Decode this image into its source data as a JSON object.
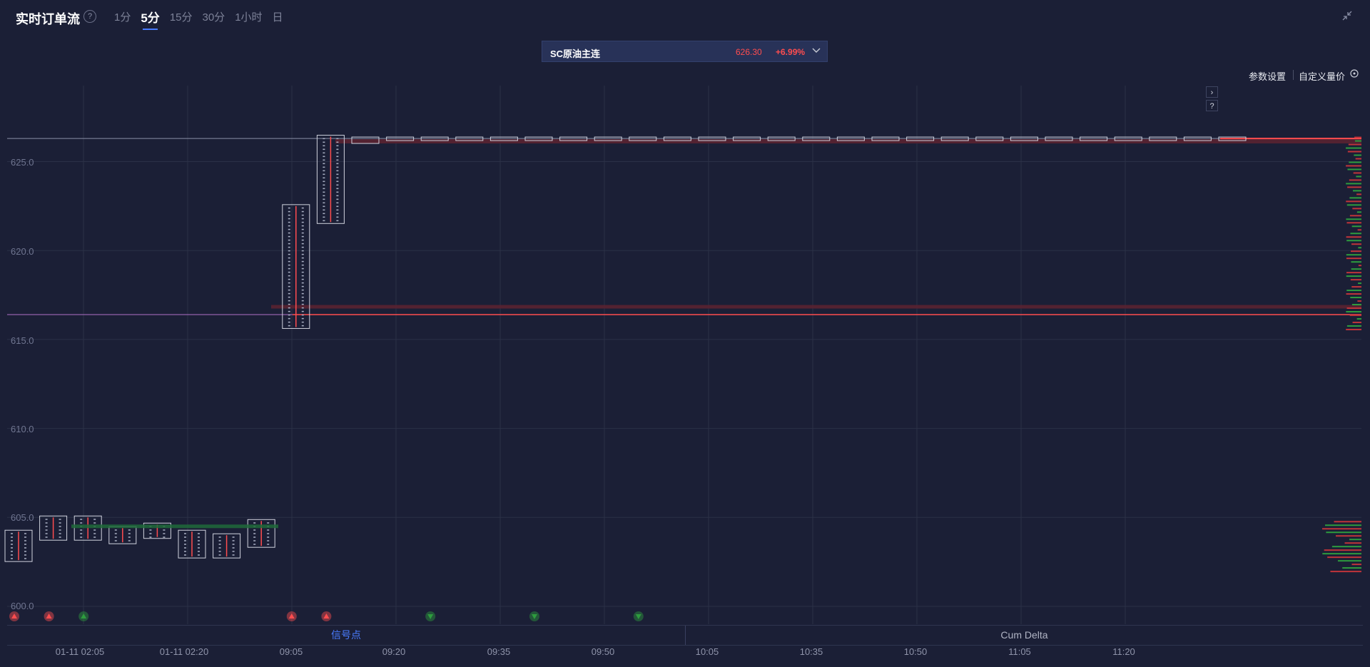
{
  "header": {
    "title": "实时订单流",
    "help_label": "?",
    "timeframes": [
      "1分",
      "5分",
      "15分",
      "30分",
      "1小时",
      "日"
    ],
    "active_timeframe": "5分",
    "collapse_icon": "collapse-arrows-icon"
  },
  "symbol": {
    "name": "SC原油主连",
    "price": "626.30",
    "change": "+6.99%",
    "dropdown_icon": "chevron-down-icon"
  },
  "toolbar": {
    "param_settings": "参数设置",
    "custom_volume_price": "自定义量价",
    "expand_label": "›",
    "help_label": "?"
  },
  "colors": {
    "background": "#1b1f36",
    "accent": "#4a7cff",
    "up_red": "#ff4d4f",
    "down_green": "#2e9c3e",
    "grid": "#2b3047",
    "candle_border": "#d0d3de"
  },
  "chart_data": {
    "type": "footprint",
    "y_ticks": [
      "625.0",
      "620.0",
      "615.0",
      "610.0",
      "605.0",
      "600.0"
    ],
    "y_range": [
      599,
      628
    ],
    "x_ticks": [
      "01-11 02:05",
      "01-11 02:20",
      "09:05",
      "09:20",
      "09:35",
      "09:50",
      "10:05",
      "10:35",
      "10:50",
      "11:05",
      "11:20"
    ],
    "reference_lines": [
      {
        "price": 626.3,
        "color": "#8a90a8"
      },
      {
        "price": 616.4,
        "color": "#b070c8"
      }
    ],
    "bars": [
      {
        "open": 602.8,
        "high": 604.2,
        "low": 602.6,
        "close": 604.0
      },
      {
        "open": 604.0,
        "high": 605.0,
        "low": 603.8,
        "close": 604.6
      },
      {
        "open": 604.4,
        "high": 605.0,
        "low": 603.8,
        "close": 604.0
      },
      {
        "open": 604.0,
        "high": 604.4,
        "low": 603.6,
        "close": 603.8
      },
      {
        "open": 603.9,
        "high": 604.6,
        "low": 603.9,
        "close": 604.4
      },
      {
        "open": 604.2,
        "high": 604.2,
        "low": 602.8,
        "close": 603.0
      },
      {
        "open": 603.2,
        "high": 604.0,
        "low": 602.8,
        "close": 603.6
      },
      {
        "open": 603.6,
        "high": 604.8,
        "low": 603.4,
        "close": 604.6
      },
      {
        "open": 615.7,
        "high": 622.5,
        "low": 615.7,
        "close": 622.0
      },
      {
        "open": 621.6,
        "high": 626.4,
        "low": 621.6,
        "close": 626.3
      },
      {
        "open": 626.3,
        "high": 626.3,
        "low": 626.1,
        "close": 626.3
      },
      {
        "open": 626.3,
        "high": 626.3,
        "low": 626.3,
        "close": 626.3
      },
      {
        "open": 626.3,
        "high": 626.3,
        "low": 626.3,
        "close": 626.3
      },
      {
        "open": 626.3,
        "high": 626.3,
        "low": 626.3,
        "close": 626.3
      },
      {
        "open": 626.3,
        "high": 626.3,
        "low": 626.3,
        "close": 626.3
      },
      {
        "open": 626.3,
        "high": 626.3,
        "low": 626.3,
        "close": 626.3
      },
      {
        "open": 626.3,
        "high": 626.3,
        "low": 626.3,
        "close": 626.3
      },
      {
        "open": 626.3,
        "high": 626.3,
        "low": 626.3,
        "close": 626.3
      },
      {
        "open": 626.3,
        "high": 626.3,
        "low": 626.3,
        "close": 626.3
      },
      {
        "open": 626.3,
        "high": 626.3,
        "low": 626.3,
        "close": 626.3
      },
      {
        "open": 626.3,
        "high": 626.3,
        "low": 626.3,
        "close": 626.3
      },
      {
        "open": 626.3,
        "high": 626.3,
        "low": 626.3,
        "close": 626.3
      },
      {
        "open": 626.3,
        "high": 626.3,
        "low": 626.3,
        "close": 626.3
      },
      {
        "open": 626.3,
        "high": 626.3,
        "low": 626.3,
        "close": 626.3
      },
      {
        "open": 626.3,
        "high": 626.3,
        "low": 626.3,
        "close": 626.3
      },
      {
        "open": 626.3,
        "high": 626.3,
        "low": 626.3,
        "close": 626.3
      },
      {
        "open": 626.3,
        "high": 626.3,
        "low": 626.3,
        "close": 626.3
      },
      {
        "open": 626.3,
        "high": 626.3,
        "low": 626.3,
        "close": 626.3
      },
      {
        "open": 626.3,
        "high": 626.3,
        "low": 626.3,
        "close": 626.3
      },
      {
        "open": 626.3,
        "high": 626.3,
        "low": 626.3,
        "close": 626.3
      },
      {
        "open": 626.3,
        "high": 626.3,
        "low": 626.3,
        "close": 626.3
      },
      {
        "open": 626.3,
        "high": 626.3,
        "low": 626.3,
        "close": 626.3
      },
      {
        "open": 626.3,
        "high": 626.3,
        "low": 626.3,
        "close": 626.3
      },
      {
        "open": 626.3,
        "high": 626.3,
        "low": 626.3,
        "close": 626.3
      },
      {
        "open": 626.3,
        "high": 626.3,
        "low": 626.3,
        "close": 626.3
      },
      {
        "open": 626.3,
        "high": 626.3,
        "low": 626.3,
        "close": 626.3
      }
    ],
    "signals": [
      {
        "bar": 0,
        "type": "up",
        "color": "#ff4d4f"
      },
      {
        "bar": 1,
        "type": "up",
        "color": "#ff4d4f"
      },
      {
        "bar": 2,
        "type": "up",
        "color": "#2e9c3e"
      },
      {
        "bar": 8,
        "type": "up",
        "color": "#ff4d4f"
      },
      {
        "bar": 9,
        "type": "up",
        "color": "#ff4d4f"
      },
      {
        "bar": 12,
        "type": "down",
        "color": "#2e9c3e"
      },
      {
        "bar": 15,
        "type": "down",
        "color": "#2e9c3e"
      },
      {
        "bar": 18,
        "type": "down",
        "color": "#2e9c3e"
      }
    ]
  },
  "bottom_panel": {
    "left_tab": "信号点",
    "right_tab": "Cum Delta"
  }
}
